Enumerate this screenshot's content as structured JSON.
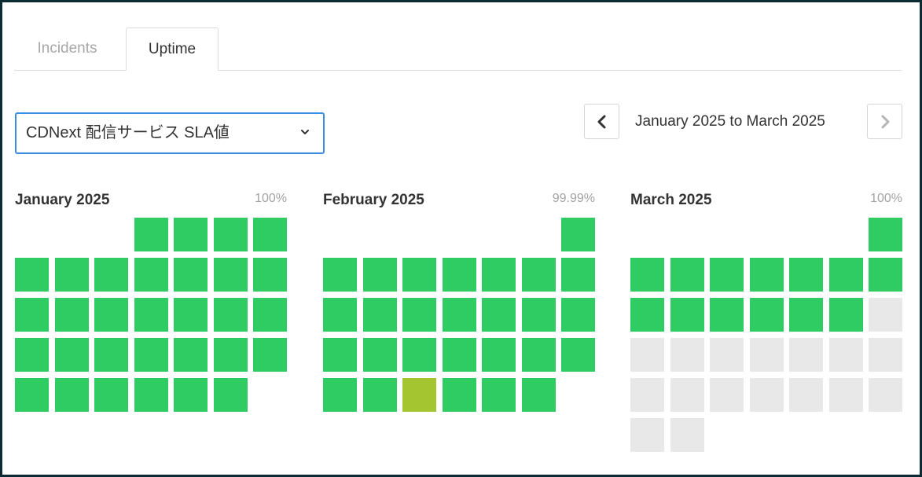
{
  "tabs": [
    {
      "label": "Incidents",
      "active": false
    },
    {
      "label": "Uptime",
      "active": true
    }
  ],
  "component_select": {
    "selected": "CDNext 配信サービス SLA値",
    "icon": "chevron-down-icon"
  },
  "date_nav": {
    "range_label": "January 2025 to March 2025",
    "prev_icon": "chevron-left-icon",
    "next_icon": "chevron-right-icon",
    "next_enabled": false
  },
  "colors": {
    "operational": "#2fcb63",
    "degraded": "#a4c530",
    "no_data": "#e8e8e8",
    "select_border": "#3c8ce0"
  },
  "months": [
    {
      "title": "January 2025",
      "uptime": "100%",
      "first_weekday": 3,
      "days": [
        "up",
        "up",
        "up",
        "up",
        "up",
        "up",
        "up",
        "up",
        "up",
        "up",
        "up",
        "up",
        "up",
        "up",
        "up",
        "up",
        "up",
        "up",
        "up",
        "up",
        "up",
        "up",
        "up",
        "up",
        "up",
        "up",
        "up",
        "up",
        "up",
        "up",
        "up"
      ]
    },
    {
      "title": "February 2025",
      "uptime": "99.99%",
      "first_weekday": 6,
      "days": [
        "up",
        "up",
        "up",
        "up",
        "up",
        "up",
        "up",
        "up",
        "up",
        "up",
        "up",
        "up",
        "up",
        "up",
        "up",
        "up",
        "up",
        "up",
        "up",
        "up",
        "up",
        "up",
        "up",
        "up",
        "partial",
        "up",
        "up",
        "up"
      ]
    },
    {
      "title": "March 2025",
      "uptime": "100%",
      "first_weekday": 6,
      "days": [
        "up",
        "up",
        "up",
        "up",
        "up",
        "up",
        "up",
        "up",
        "up",
        "up",
        "up",
        "up",
        "up",
        "up",
        "future",
        "future",
        "future",
        "future",
        "future",
        "future",
        "future",
        "future",
        "future",
        "future",
        "future",
        "future",
        "future",
        "future",
        "future",
        "future",
        "future"
      ]
    }
  ]
}
